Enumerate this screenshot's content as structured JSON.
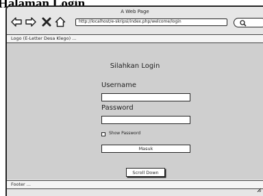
{
  "page": {
    "heading": "Halaman Login"
  },
  "browser": {
    "window_title": "A Web Page",
    "url": "http://localhost/e-skripsi/index.php/welcome/login",
    "icons": [
      "back-arrow-icon",
      "forward-arrow-icon",
      "close-x-icon",
      "home-icon",
      "search-icon",
      "resize-grip-icon"
    ]
  },
  "topbar": {
    "text": "Logo  (E-Letter Desa Klego)  ..."
  },
  "login": {
    "title": "Silahkan Login",
    "username_label": "Username",
    "username_value": "",
    "password_label": "Password",
    "password_value": "",
    "show_password_label": "Show Password",
    "show_password_checked": false,
    "submit_label": "Masuk",
    "scroll_label": "Scroll Down"
  },
  "footer": {
    "text": "Footer  ..."
  }
}
